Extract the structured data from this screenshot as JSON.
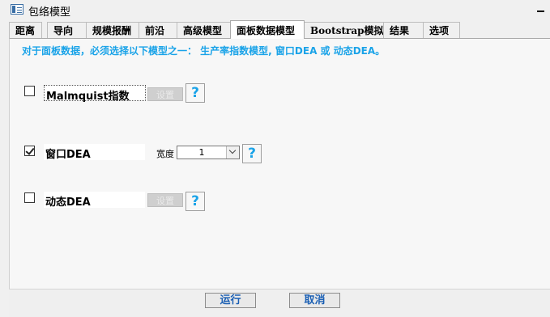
{
  "window": {
    "title": "包络模型"
  },
  "tabs": [
    {
      "label": "距离"
    },
    {
      "label": "导向"
    },
    {
      "label": "规模报酬"
    },
    {
      "label": "前沿"
    },
    {
      "label": "高级模型"
    },
    {
      "label": "面板数据模型"
    },
    {
      "label": "Bootstrap模拟"
    },
    {
      "label": "结果"
    },
    {
      "label": "选项"
    }
  ],
  "panel": {
    "info": "对于面板数据，必须选择以下模型之一：  生产率指数模型, 窗口DEA 或 动态DEA。",
    "malmquist": {
      "label": "Malmquist指数",
      "checked": false,
      "settings": "设置",
      "help": "?"
    },
    "window_dea": {
      "label": "窗口DEA",
      "checked": true,
      "width_label": "宽度",
      "width_value": "1",
      "help": "?"
    },
    "dynamic_dea": {
      "label": "动态DEA",
      "checked": false,
      "settings": "设置",
      "help": "?"
    }
  },
  "footer": {
    "run": "运行",
    "cancel": "取消"
  }
}
